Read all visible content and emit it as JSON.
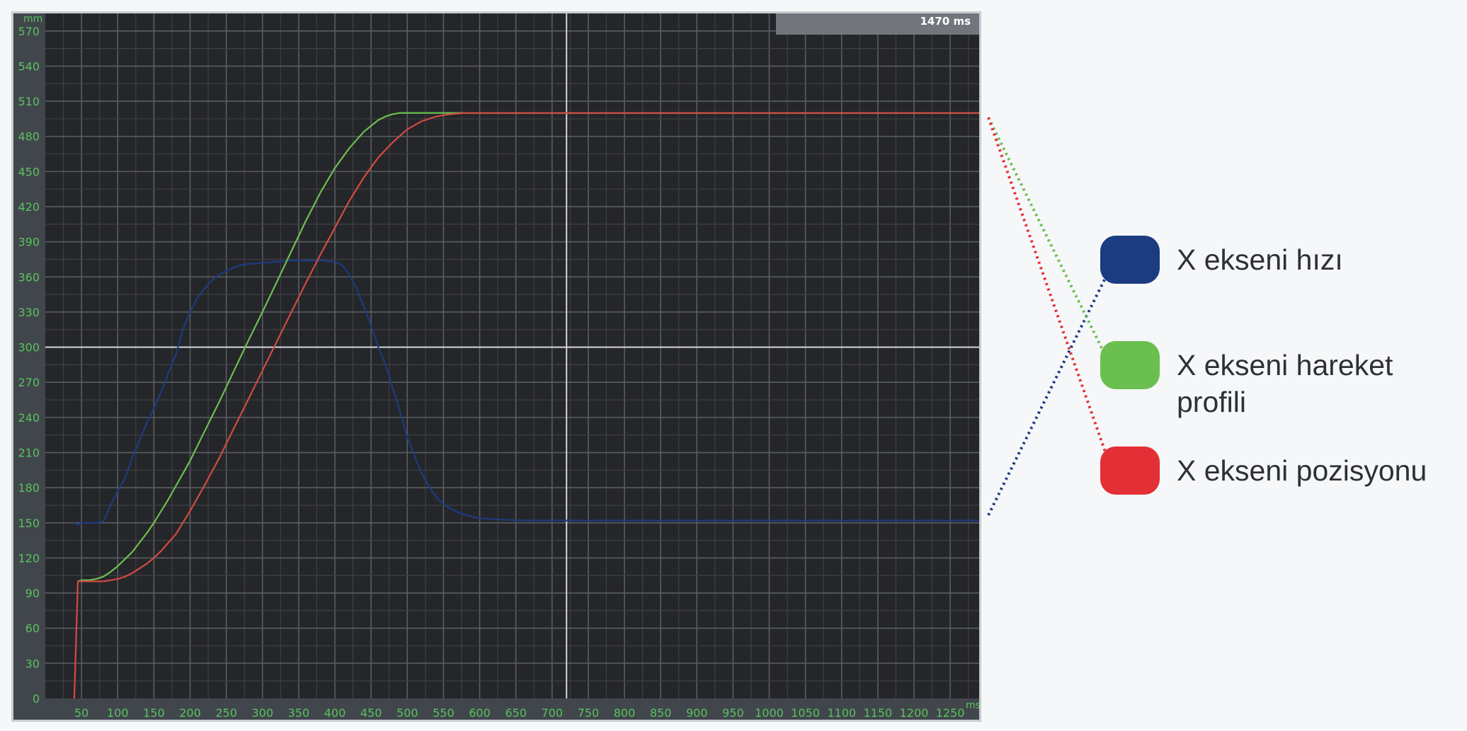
{
  "chart_data": {
    "type": "line",
    "xlabel": "ms",
    "ylabel": "mm",
    "xlim": [
      0,
      1290
    ],
    "ylim": [
      0,
      585
    ],
    "x_ticks": [
      50,
      100,
      150,
      200,
      250,
      300,
      350,
      400,
      450,
      500,
      550,
      600,
      650,
      700,
      750,
      800,
      850,
      900,
      950,
      1000,
      1050,
      1100,
      1150,
      1200,
      1250
    ],
    "y_ticks": [
      0,
      30,
      60,
      90,
      120,
      150,
      180,
      210,
      240,
      270,
      300,
      330,
      360,
      390,
      420,
      450,
      480,
      510,
      540,
      570
    ],
    "grid": true,
    "cursor": {
      "x": 720,
      "y": 300
    },
    "time_badge": "1470 ms",
    "series": [
      {
        "name": "X ekseni hızı",
        "color": "#1d3b82",
        "x": [
          40,
          45,
          50,
          60,
          70,
          80,
          90,
          100,
          110,
          120,
          130,
          140,
          150,
          160,
          170,
          180,
          190,
          200,
          210,
          220,
          230,
          240,
          250,
          260,
          270,
          280,
          300,
          320,
          340,
          360,
          380,
          400,
          410,
          420,
          430,
          440,
          450,
          460,
          470,
          480,
          490,
          500,
          510,
          520,
          530,
          540,
          550,
          560,
          570,
          580,
          590,
          600,
          620,
          640,
          660,
          680,
          700,
          750,
          800,
          900,
          1000,
          1100,
          1200,
          1290
        ],
        "y": [
          150,
          148,
          150,
          150,
          150,
          151,
          165,
          177,
          188,
          205,
          220,
          235,
          248,
          262,
          278,
          293,
          315,
          330,
          342,
          350,
          357,
          362,
          365,
          368,
          370,
          371,
          372,
          373,
          374,
          374,
          374,
          373,
          370,
          362,
          350,
          335,
          318,
          300,
          285,
          265,
          245,
          223,
          207,
          192,
          181,
          172,
          166,
          162,
          159,
          157,
          155,
          154,
          153,
          152.5,
          152,
          152,
          152,
          152,
          152,
          152,
          152,
          152,
          152,
          152
        ]
      },
      {
        "name": "X ekseni hareket profili",
        "color": "#6bbf4f",
        "x": [
          45,
          50,
          60,
          70,
          80,
          90,
          100,
          110,
          120,
          130,
          140,
          150,
          160,
          170,
          180,
          190,
          200,
          220,
          240,
          260,
          280,
          300,
          320,
          340,
          360,
          380,
          400,
          420,
          440,
          460,
          470,
          480,
          490,
          500,
          510,
          520,
          530,
          540,
          560,
          580,
          600,
          650,
          700,
          750,
          800,
          900,
          1000,
          1100,
          1200,
          1290
        ],
        "y": [
          100,
          101,
          101,
          102,
          104,
          108,
          113,
          119,
          125,
          133,
          141,
          150,
          160,
          170,
          181,
          192,
          203,
          228,
          253,
          279,
          305,
          330,
          356,
          382,
          408,
          432,
          453,
          470,
          484,
          494,
          497,
          499,
          500,
          500,
          500,
          500,
          500,
          500,
          500,
          500,
          500,
          500,
          500,
          500,
          500,
          500,
          500,
          500,
          500,
          500
        ]
      },
      {
        "name": "X ekseni pozisyonu",
        "color": "#d24a44",
        "x": [
          40,
          45,
          50,
          60,
          70,
          80,
          90,
          100,
          110,
          120,
          130,
          140,
          150,
          160,
          170,
          180,
          190,
          200,
          220,
          240,
          260,
          280,
          300,
          320,
          340,
          360,
          380,
          400,
          420,
          440,
          460,
          480,
          500,
          520,
          540,
          560,
          580,
          600,
          620,
          640,
          660,
          680,
          700,
          720,
          750,
          800,
          900,
          1000,
          1100,
          1200,
          1290
        ],
        "y": [
          0,
          100,
          100,
          100,
          100,
          100,
          101,
          102,
          104,
          107,
          111,
          115,
          120,
          126,
          133,
          140,
          150,
          160,
          182,
          205,
          230,
          255,
          280,
          305,
          330,
          355,
          379,
          402,
          425,
          445,
          462,
          475,
          486,
          493,
          497,
          499,
          500,
          500,
          500,
          500,
          500,
          500,
          500,
          500,
          500,
          500,
          500,
          500,
          500,
          500,
          500
        ]
      }
    ]
  },
  "legend": {
    "items": [
      {
        "label": "X ekseni hızı",
        "color": "#1c3c81",
        "line_color": "#1d3b82"
      },
      {
        "label": "X ekseni hareket profili",
        "color": "#6bbf4f",
        "line_color": "#6bbf4f"
      },
      {
        "label": "X ekseni pozisyonu",
        "color": "#e32f35",
        "line_color": "#e32f35"
      }
    ]
  }
}
